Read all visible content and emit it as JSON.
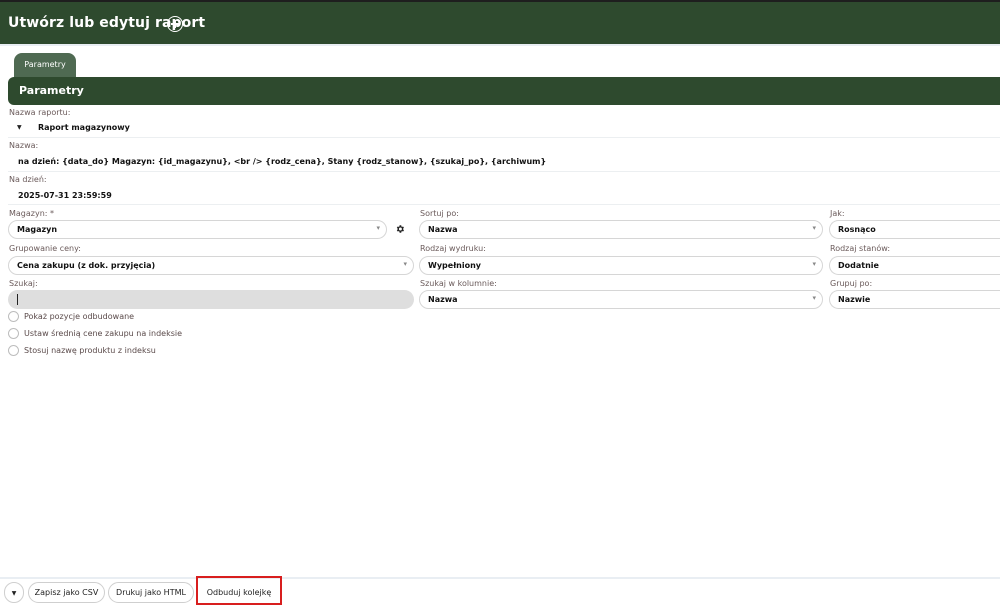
{
  "header": {
    "title": "Utwórz lub edytuj raport"
  },
  "tabs": [
    {
      "label": "Parametry"
    }
  ],
  "section": {
    "title": "Parametry"
  },
  "fields": {
    "report_name": {
      "label": "Nazwa raportu:",
      "value": "Raport magazynowy"
    },
    "name": {
      "label": "Nazwa:",
      "value": "na dzień: {data_do}  Magazyn: {id_magazynu}, <br /> {rodz_cena}, Stany {rodz_stanow}, {szukaj_po}, {archiwum}"
    },
    "as_of": {
      "label": "Na dzień:",
      "value": "2025-07-31 23:59:59"
    },
    "warehouse": {
      "label": "Magazyn: *",
      "value": "Magazyn"
    },
    "sort_by": {
      "label": "Sortuj po:",
      "value": "Nazwa"
    },
    "order": {
      "label": "Jak:",
      "value": "Rosnąco"
    },
    "price_grouping": {
      "label": "Grupowanie ceny:",
      "value": "Cena zakupu (z dok. przyjęcia)"
    },
    "print_type": {
      "label": "Rodzaj wydruku:",
      "value": "Wypełniony"
    },
    "stock_type": {
      "label": "Rodzaj stanów:",
      "value": "Dodatnie"
    },
    "search": {
      "label": "Szukaj:",
      "value": ""
    },
    "search_column": {
      "label": "Szukaj w kolumnie:",
      "value": "Nazwa"
    },
    "group_by": {
      "label": "Grupuj po:",
      "value": "Nazwie"
    }
  },
  "checkboxes": [
    {
      "label": "Pokaż pozycje odbudowane",
      "checked": false
    },
    {
      "label": "Ustaw średnią cene zakupu na indeksie",
      "checked": false
    },
    {
      "label": "Stosuj nazwę produktu z indeksu",
      "checked": false
    }
  ],
  "footer": {
    "csv_label": "Zapisz jako CSV",
    "html_label": "Drukuj jako HTML",
    "rebuild_label": "Odbuduj kolejkę"
  },
  "icons": {
    "add": "plus-circle-icon",
    "caret": "caret-down-icon",
    "gear": "gear-icon",
    "chevron": "chevron-down-icon"
  },
  "colors": {
    "header_bg": "#2e4a2e",
    "tab_bg": "#4f6a52",
    "highlight": "#d81e1e"
  }
}
